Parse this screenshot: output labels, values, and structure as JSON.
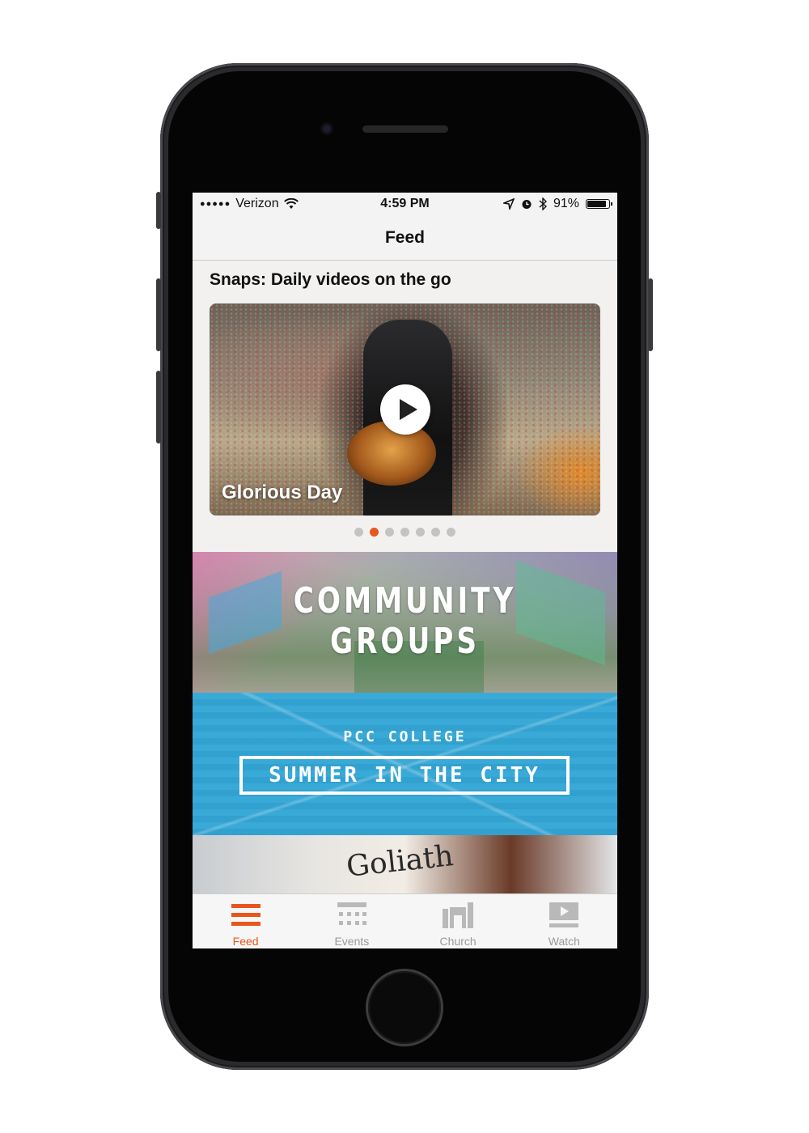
{
  "status_bar": {
    "signal": "●●●●●",
    "carrier": "Verizon",
    "time": "4:59 PM",
    "battery_percent": "91%",
    "battery_level": 0.91
  },
  "nav": {
    "title": "Feed"
  },
  "snaps": {
    "section_title": "Snaps: Daily videos on the go",
    "video_title": "Glorious Day",
    "page_count": 7,
    "active_page": 2
  },
  "banners": {
    "community": {
      "line1": "COMMUNITY",
      "line2": "GROUPS"
    },
    "college": {
      "subtitle": "PCC COLLEGE",
      "title": "SUMMER IN THE CITY"
    },
    "book": {
      "text": "Goliath"
    }
  },
  "tabs": [
    {
      "label": "Feed",
      "icon": "menu-icon",
      "active": true
    },
    {
      "label": "Events",
      "icon": "calendar-grid-icon",
      "active": false
    },
    {
      "label": "Church",
      "icon": "church-icon",
      "active": false
    },
    {
      "label": "Watch",
      "icon": "video-play-icon",
      "active": false
    }
  ],
  "colors": {
    "accent": "#e8561e",
    "college_blue": "#33a6d6"
  }
}
